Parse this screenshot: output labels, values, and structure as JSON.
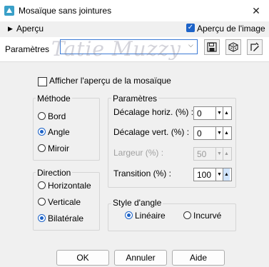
{
  "window": {
    "title": "Mosaïque sans jointures",
    "close_glyph": "✕",
    "app_icon": "psp-icon"
  },
  "preview": {
    "label": "Aperçu",
    "arrow": "▶",
    "image_preview_label": "Aperçu de l'image",
    "image_preview_checked": true,
    "check_glyph": "✓"
  },
  "presets": {
    "label": "Paramètres",
    "value": "",
    "arrow": "⌵",
    "watermark": "Tatie Muzzy"
  },
  "toolbar": {
    "save_icon": "save-icon",
    "reset_icon": "dice-icon",
    "options_icon": "edit-options-icon"
  },
  "show_mosaic_preview": {
    "label": "Afficher l'aperçu de la mosaïque",
    "checked": false
  },
  "method": {
    "legend": "Méthode",
    "options": [
      {
        "label": "Bord",
        "selected": false
      },
      {
        "label": "Angle",
        "selected": true
      },
      {
        "label": "Miroir",
        "selected": false
      }
    ]
  },
  "direction": {
    "legend": "Direction",
    "options": [
      {
        "label": "Horizontale",
        "selected": false
      },
      {
        "label": "Verticale",
        "selected": false
      },
      {
        "label": "Bilatérale",
        "selected": true
      }
    ]
  },
  "params": {
    "legend": "Paramètres",
    "fields": [
      {
        "label": "Décalage horiz. (%) :",
        "value": "0",
        "enabled": true
      },
      {
        "label": "Décalage vert. (%) :",
        "value": "0",
        "enabled": true
      },
      {
        "label": "Largeur (%) :",
        "value": "50",
        "enabled": false
      },
      {
        "label": "Transition (%) :",
        "value": "100",
        "enabled": true
      }
    ]
  },
  "corner_style": {
    "legend": "Style d'angle",
    "options": [
      {
        "label": "Linéaire",
        "selected": true
      },
      {
        "label": "Incurvé",
        "selected": false
      }
    ]
  },
  "buttons": {
    "ok": "OK",
    "cancel": "Annuler",
    "help": "Aide"
  },
  "colors": {
    "accent": "#1d63c8",
    "background": "#f0f0f0"
  }
}
